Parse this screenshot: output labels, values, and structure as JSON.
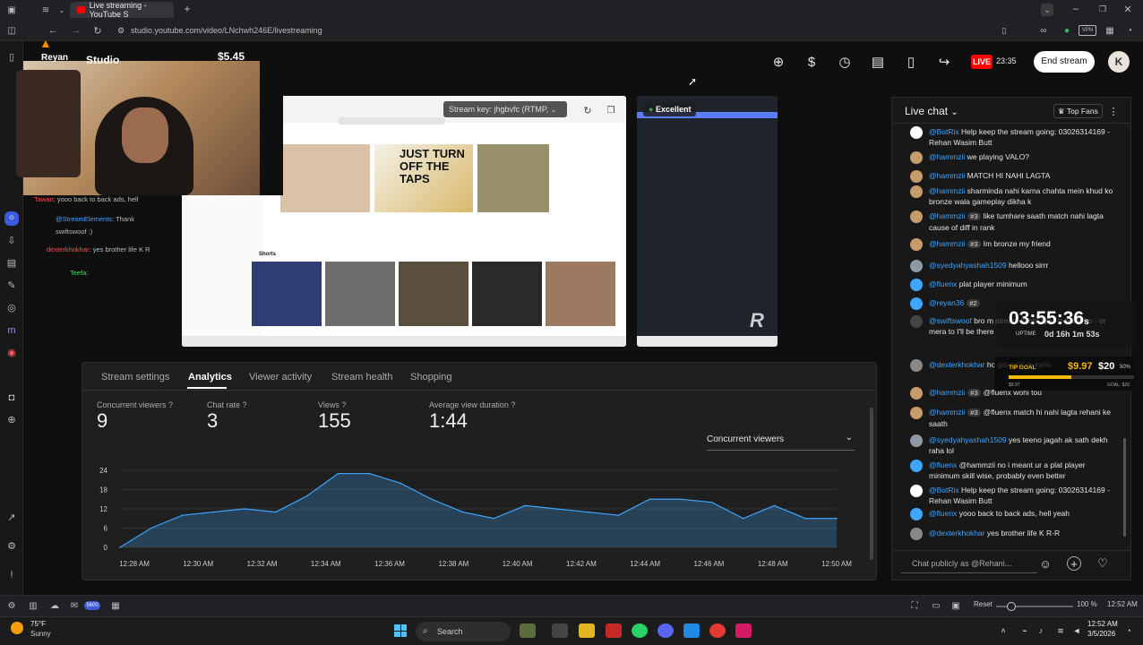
{
  "browser": {
    "tab_title": "Live streaming - YouTube S",
    "url": "studio.youtube.com/video/LNchwh246E/livestreaming"
  },
  "overlay": {
    "name": "Reyan",
    "studio_label": "Studio",
    "donation": "$5.45",
    "timer": "03:55:36",
    "timer_suffix": "s",
    "uptime_label": "UPTIME",
    "uptime": "0d 16h 1m 53s",
    "tip_label": "TIP GOAL",
    "tip_current": "$9.97",
    "tip_goal": "$20",
    "tip_pct": "50%",
    "tip_progress": 0.5,
    "tip_sub1": "$9.97",
    "tip_sub2": "GOAL: $20"
  },
  "header": {
    "live_badge": "LIVE",
    "live_time": "23:35",
    "end_stream": "End stream"
  },
  "preview": {
    "stream_key": "Stream key: jhgbvfc (RTMP,",
    "quality": "Excellent",
    "shorts_label": "Shorts",
    "thumb_title": "JUST TURN OFF THE TAPS"
  },
  "overlay_chat": [
    {
      "author": "Tawan",
      "text": ": yooo back to back ads, hell"
    },
    {
      "author": "@StreamElements",
      "text": ": Thank",
      "extra": "swiftswoof :)"
    },
    {
      "author": "dexterkhokhar",
      "text": ": yes brother life K R"
    },
    {
      "author": "Teefa",
      "text": ":"
    }
  ],
  "tabs": [
    "Stream settings",
    "Analytics",
    "Viewer activity",
    "Stream health",
    "Shopping"
  ],
  "metrics": [
    {
      "label": "Concurrent viewers",
      "value": "9"
    },
    {
      "label": "Chat rate",
      "value": "3"
    },
    {
      "label": "Views",
      "value": "155"
    },
    {
      "label": "Average view duration",
      "value": "1:44"
    }
  ],
  "chart_select": "Concurrent viewers",
  "chart_data": {
    "type": "area",
    "x": [
      "12:28 AM",
      "12:30 AM",
      "12:32 AM",
      "12:34 AM",
      "12:36 AM",
      "12:38 AM",
      "12:40 AM",
      "12:42 AM",
      "12:44 AM",
      "12:46 AM",
      "12:48 AM",
      "12:50 AM"
    ],
    "series": [
      {
        "values": [
          0,
          6,
          10,
          11,
          12,
          11,
          16,
          23,
          23,
          20,
          15,
          11,
          9,
          13,
          12,
          11,
          10,
          15,
          15,
          14,
          9,
          13,
          9,
          9
        ]
      }
    ],
    "y_ticks": [
      "24",
      "18",
      "12",
      "6",
      "0"
    ],
    "ylim": [
      0,
      24
    ],
    "grid": true,
    "color": "#3ea6ff"
  },
  "chat": {
    "title": "Live chat",
    "top_fans": "Top Fans",
    "input_placeholder": "Chat publicly as @Rehani...",
    "messages": [
      {
        "author": "@BotRix",
        "text": "Help keep the stream going: 03026314169 - Rehan Wasim Butt",
        "color": "#ffffff"
      },
      {
        "author": "@hammzii",
        "text": "we playing VALO?",
        "color": "#c69c6d"
      },
      {
        "author": "@hammzii",
        "text": "MATCH HI NAHI LAGTA",
        "color": "#c69c6d"
      },
      {
        "author": "@hammzii",
        "text": "sharminda nahi karna chahta mein khud ko bronze wala gameplay dikha k",
        "color": "#c69c6d"
      },
      {
        "author": "@hammzii",
        "badge": "#3",
        "text": "like tumhare saath match nahi lagta cause of diff in rank",
        "color": "#c69c6d"
      },
      {
        "author": "@hammzii",
        "badge": "#3",
        "text": "Im bronze my friend",
        "color": "#c69c6d"
      },
      {
        "author": "@syedyahyashah1509",
        "text": "hellooo sirrr",
        "color": "#8d99a6"
      },
      {
        "author": "@fluenx",
        "text": "plat player minimum",
        "color": "#3ea6ff"
      },
      {
        "author": "@reyan36",
        "badge": "#2",
        "text": "",
        "color": "#3ea6ff"
      },
      {
        "author": "@swiftswoof",
        "text": "bro m stream ki bhi apki st bahir ho - or mera to I'll be there",
        "color": "#444"
      },
      {
        "author": "@dexterkhokhar",
        "text": "ho gai nahi to karlo",
        "color": "#888"
      },
      {
        "author": "@hammzii",
        "badge": "#3",
        "text": "@fluenx wohi tou",
        "color": "#c69c6d"
      },
      {
        "author": "@hammzii",
        "badge": "#3",
        "text": "@fluenx match hi nahi lagta rehani ke saath",
        "color": "#c69c6d"
      },
      {
        "author": "@syedyahyashah1509",
        "text": "yes teeno jagah ak sath dekh raha lol",
        "color": "#8d99a6"
      },
      {
        "author": "@fluenx",
        "text": "@hammzii no i meant ur a plat player minimum skill wise, probably even better",
        "color": "#3ea6ff"
      },
      {
        "author": "@BotRix",
        "text": "Help keep the stream going: 03026314169 - Rehan Wasim Butt",
        "color": "#ffffff"
      },
      {
        "author": "@fluenx",
        "text": "yooo back to back ads, hell yeah",
        "color": "#3ea6ff"
      },
      {
        "author": "@dexterkhokhar",
        "text": "yes brother life K R-R",
        "color": "#888"
      }
    ]
  },
  "statusbar": {
    "reset": "Reset",
    "zoom": "100 %",
    "time": "12:52 AM",
    "badge": "5600"
  },
  "taskbar": {
    "weather_temp": "75°F",
    "weather_desc": "Sunny",
    "search": "Search",
    "clock_time": "12:52 AM",
    "clock_date": "3/5/2026"
  }
}
